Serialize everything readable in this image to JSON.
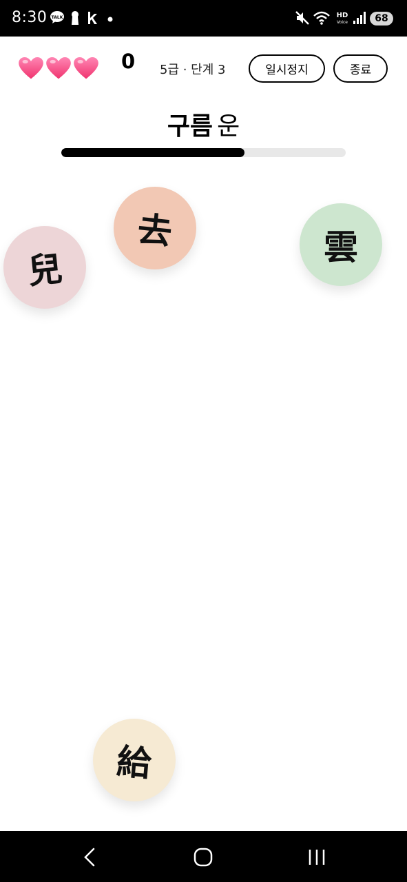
{
  "status_bar": {
    "time": "8:30",
    "left_icons": [
      "kakaotalk-icon",
      "keyhole-icon",
      "k-app-icon",
      "dot-icon"
    ],
    "right_icons": [
      "mute-icon",
      "wifi-icon",
      "hd-voice-icon",
      "signal-icon"
    ],
    "battery": "68"
  },
  "game": {
    "lives": 3,
    "score": "0",
    "level": "5급 · 단계 3",
    "pause_label": "일시정지",
    "quit_label": "종료",
    "prompt": {
      "meaning": "구름",
      "sound": "운"
    },
    "progress": 0.645,
    "bubbles": [
      {
        "char": "兒",
        "color": "#edd5d7",
        "rotation": "-6deg"
      },
      {
        "char": "去",
        "color": "#f2c8b4",
        "rotation": "6deg"
      },
      {
        "char": "雲",
        "color": "#cde6cf",
        "rotation": "0deg"
      },
      {
        "char": "給",
        "color": "#f6ead3",
        "rotation": "5deg"
      }
    ]
  },
  "nav_bar": {
    "icons": [
      "back-icon",
      "home-icon",
      "recents-icon"
    ]
  }
}
